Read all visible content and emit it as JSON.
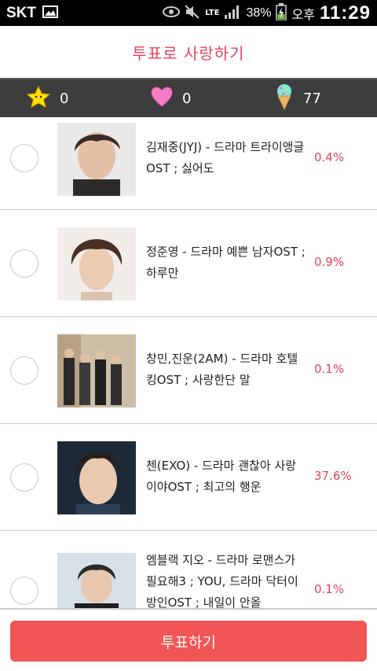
{
  "status_bar": {
    "carrier": "SKT",
    "network": "LTE",
    "battery": "38%",
    "ampm": "오후",
    "time": "11:29"
  },
  "header": {
    "title": "투표로 사랑하기"
  },
  "stats": {
    "star_count": "0",
    "heart_count": "0",
    "icecream_count": "77"
  },
  "colors": {
    "accent": "#e8415a",
    "button": "#f25555",
    "stats_bar": "#3d3d3d"
  },
  "items": [
    {
      "song": "김재중(JYJ) - 드라마 트라이앵글OST ; 싫어도",
      "percent": "0.4%"
    },
    {
      "song": "정준영 - 드라마 예쁜 남자OST ; 하루만",
      "percent": "0.9%"
    },
    {
      "song": "창민,진운(2AM) - 드라마 호텔킹OST ; 사랑한단 말",
      "percent": "0.1%"
    },
    {
      "song": "첸(EXO) - 드라마 괜찮아 사랑이야OST ; 최고의 행운",
      "percent": "37.6%"
    },
    {
      "song": "엠블랙 지오 - 드라마 로맨스가 필요해3 ; YOU, 드라마 닥터이방인OST ; 내일이 안올",
      "percent": "0.1%"
    }
  ],
  "footer": {
    "vote_label": "투표하기"
  }
}
